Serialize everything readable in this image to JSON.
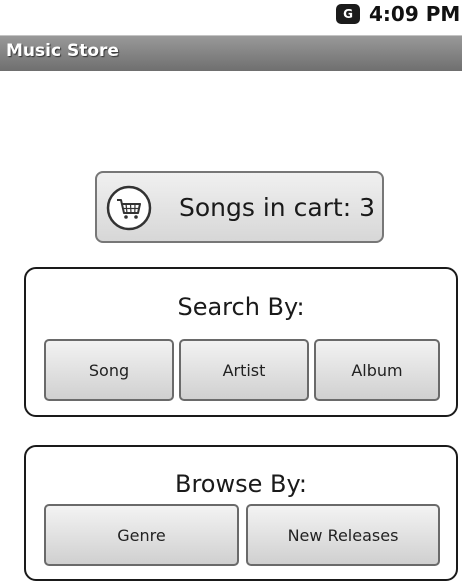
{
  "status_bar": {
    "notification_icon": "talk-icon",
    "notification_glyph": "G",
    "time": "4:09 PM"
  },
  "title_bar": {
    "title": "Music Store"
  },
  "cart": {
    "icon": "shopping-cart-icon",
    "label": "Songs in cart: 3"
  },
  "search_panel": {
    "title": "Search By:",
    "buttons": [
      "Song",
      "Artist",
      "Album"
    ]
  },
  "browse_panel": {
    "title": "Browse By:",
    "buttons": [
      "Genre",
      "New Releases"
    ]
  },
  "colors": {
    "title_bar": "#7f7f7f",
    "panel_border": "#1a1a1a",
    "button_fill": "#e2e2e2"
  }
}
